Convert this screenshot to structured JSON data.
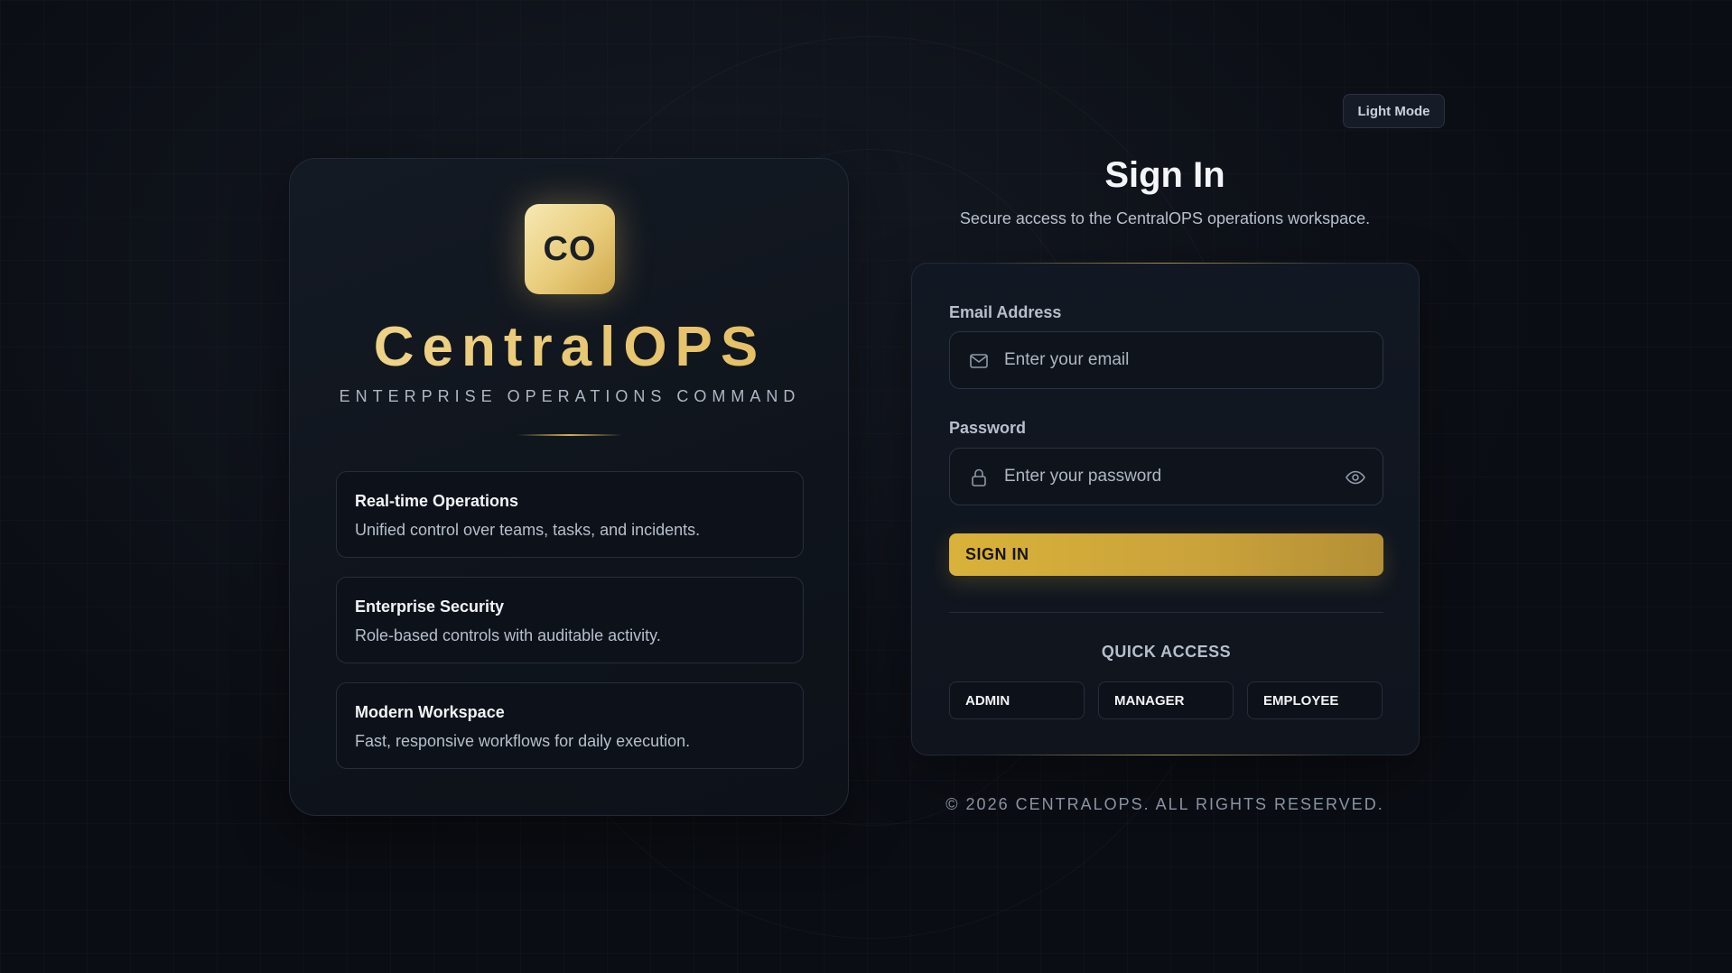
{
  "theme_toggle": {
    "label": "Light Mode"
  },
  "brand": {
    "logo_text": "CO",
    "name": "CentralOPS",
    "tagline": "ENTERPRISE OPERATIONS COMMAND",
    "accent_color": "#e6c46e"
  },
  "features": [
    {
      "title": "Real-time Operations",
      "description": "Unified control over teams, tasks, and incidents."
    },
    {
      "title": "Enterprise Security",
      "description": "Role-based controls with auditable activity."
    },
    {
      "title": "Modern Workspace",
      "description": "Fast, responsive workflows for daily execution."
    }
  ],
  "signin": {
    "title": "Sign In",
    "subtitle": "Secure access to the CentralOPS operations workspace.",
    "email": {
      "label": "Email Address",
      "placeholder": "Enter your email",
      "value": "",
      "icon": "mail-icon"
    },
    "password": {
      "label": "Password",
      "placeholder": "Enter your password",
      "value": "",
      "icon": "lock-icon",
      "toggle_icon": "eye-icon"
    },
    "submit_label": "SIGN IN",
    "button_color": "#d2ab3a",
    "quick_access": {
      "title": "QUICK ACCESS",
      "roles": [
        "ADMIN",
        "MANAGER",
        "EMPLOYEE"
      ]
    }
  },
  "footer": {
    "copyright": "© 2026 CENTRALOPS. ALL RIGHTS RESERVED."
  }
}
